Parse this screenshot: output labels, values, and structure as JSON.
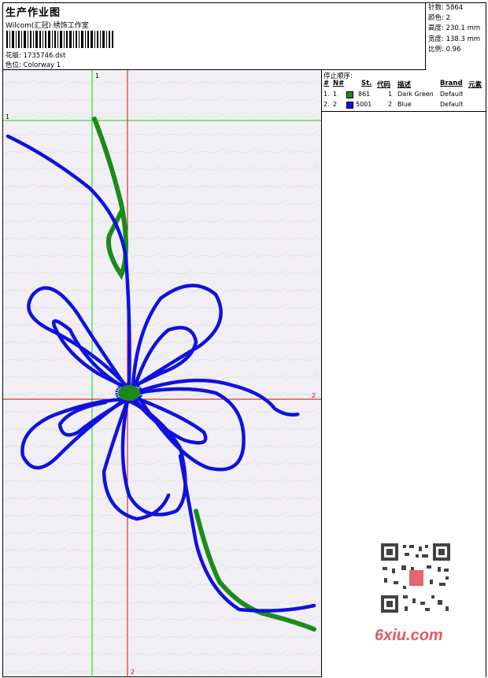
{
  "header": {
    "title": "生产作业图",
    "company": "Wilcom(汇冠) 绣饰工作室",
    "design_label": "花版: 1735746.dst",
    "colorway_label": "色位: Colorway 1"
  },
  "stats": {
    "stitches": "针数: 5864",
    "colors": "颜色: 2",
    "height": "高度: 230.1 mm",
    "width": "宽度: 138.3 mm",
    "scale": "比例: 0.96"
  },
  "stop_sequence": {
    "title": "停止顺序:",
    "columns": [
      "#",
      "N#",
      "St.",
      "代码",
      "描述",
      "Brand",
      "元素"
    ],
    "rows": [
      {
        "index": "1.",
        "needle": "1",
        "color": "#1a8c1a",
        "stitches": "861",
        "code": "1",
        "desc": "Dark Green",
        "brand": "Default"
      },
      {
        "index": "2.",
        "needle": "2",
        "color": "#1010e0",
        "stitches": "5001",
        "code": "2",
        "desc": "Blue",
        "brand": "Default"
      }
    ]
  },
  "guides": {
    "v1": "1",
    "h1": "1",
    "h2": "2",
    "v2": "2"
  },
  "colors": {
    "green_thread": "#1a8c1a",
    "blue_thread": "#1010e0",
    "guide_green": "#00dd00",
    "guide_red": "#e00000"
  },
  "watermark": {
    "site": "6xiu.com"
  }
}
